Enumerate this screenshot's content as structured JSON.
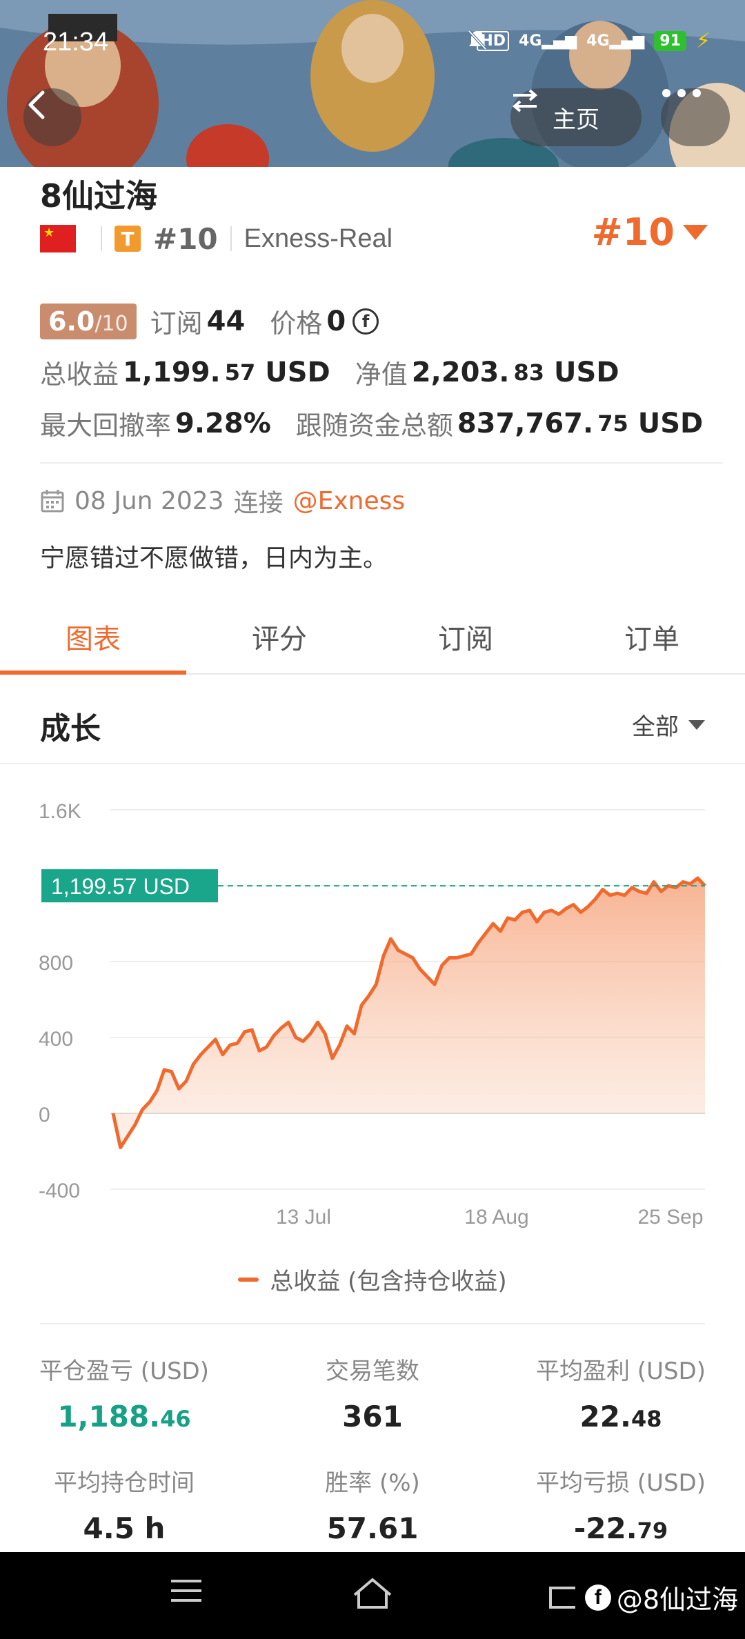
{
  "status_bar": {
    "time": "21:34",
    "hd_label": "HD",
    "net1": "4G",
    "net2": "4G",
    "battery": "91"
  },
  "top_actions": {
    "home_label": "主页"
  },
  "profile": {
    "name": "8仙过海",
    "rank_small": "#10",
    "broker": "Exness-Real",
    "rank_big": "#10",
    "score": "6.0",
    "score_den": "/10",
    "subscribers_label": "订阅",
    "subscribers_value": "44",
    "price_label": "价格",
    "price_value": "0",
    "total_return_label": "总收益",
    "total_return_int": "1,199.",
    "total_return_dec": "57",
    "total_return_unit": "USD",
    "equity_label": "净值",
    "equity_int": "2,203.",
    "equity_dec": "83",
    "equity_unit": "USD",
    "drawdown_label": "最大回撤率",
    "drawdown_value": "9.28%",
    "follow_label": "跟随资金总额",
    "follow_int": "837,767.",
    "follow_dec": "75",
    "follow_unit": "USD",
    "joined_date": "08 Jun 2023",
    "joined_text": "连接",
    "joined_link": "@Exness",
    "bio": "宁愿错过不愿做错，日内为主。"
  },
  "tabs": [
    {
      "label": "图表"
    },
    {
      "label": "评分"
    },
    {
      "label": "订阅"
    },
    {
      "label": "订单"
    }
  ],
  "growth": {
    "title": "成长",
    "range": "全部"
  },
  "chart_data": {
    "type": "area",
    "y_ticks": [
      "1.6K",
      "800",
      "400",
      "0",
      "-400"
    ],
    "x_ticks": [
      "13 Jul",
      "18 Aug",
      "25 Sep"
    ],
    "ylim": [
      -400,
      1600
    ],
    "current_label": "1,199.57 USD",
    "current_value": 1199.57,
    "legend": "总收益 (包含持仓收益)",
    "values": [
      0,
      -180,
      -120,
      -60,
      20,
      60,
      120,
      230,
      220,
      130,
      170,
      260,
      310,
      350,
      390,
      310,
      360,
      370,
      430,
      440,
      330,
      350,
      410,
      450,
      480,
      400,
      380,
      420,
      480,
      420,
      290,
      360,
      460,
      420,
      570,
      620,
      680,
      830,
      920,
      860,
      840,
      820,
      760,
      720,
      680,
      780,
      820,
      820,
      830,
      840,
      900,
      950,
      1000,
      960,
      1030,
      1020,
      1060,
      1070,
      1010,
      1060,
      1070,
      1050,
      1080,
      1100,
      1060,
      1090,
      1130,
      1180,
      1150,
      1160,
      1150,
      1190,
      1170,
      1160,
      1220,
      1170,
      1200,
      1190,
      1220,
      1210,
      1240,
      1199.57
    ]
  },
  "metrics": [
    {
      "label": "平仓盈亏 (USD)",
      "int": "1,188.",
      "dec": "46",
      "green": true
    },
    {
      "label": "交易笔数",
      "int": "361",
      "dec": "",
      "green": false
    },
    {
      "label": "平均盈利 (USD)",
      "int": "22.",
      "dec": "48",
      "green": false
    },
    {
      "label": "平均持仓时间",
      "int": "4.5 h",
      "dec": "",
      "green": false
    },
    {
      "label": "胜率 (%)",
      "int": "57.61",
      "dec": "",
      "green": false
    },
    {
      "label": "平均亏损 (USD)",
      "int": "-22.",
      "dec": "79",
      "green": false
    }
  ],
  "watermark": "@8仙过海",
  "colors": {
    "accent": "#f06a2e",
    "green": "#16a086",
    "tag_teal": "#1aa68a"
  }
}
